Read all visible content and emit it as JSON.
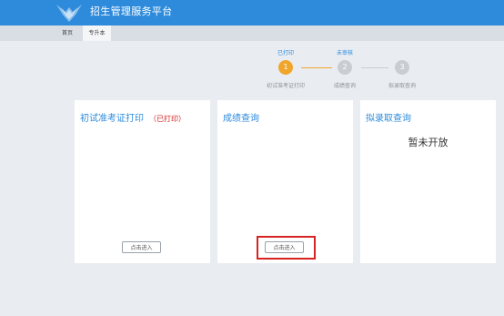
{
  "header": {
    "app_title": "招生管理服务平台"
  },
  "nav": {
    "items": [
      {
        "label": "首页"
      },
      {
        "label": "专升本"
      }
    ]
  },
  "steps": [
    {
      "status": "已打印",
      "number": "1",
      "label": "初试准考证打印"
    },
    {
      "status": "未审核",
      "number": "2",
      "label": "成绩查询"
    },
    {
      "status": "",
      "number": "3",
      "label": "拟录取查询"
    }
  ],
  "cards": [
    {
      "title": "初试准考证打印",
      "status": "（已打印）",
      "button": "点击进入"
    },
    {
      "title": "成绩查询",
      "button": "点击进入"
    },
    {
      "title": "拟录取查询",
      "message": "暂未开放"
    }
  ],
  "colors": {
    "header_bg": "#2e8bdc",
    "accent": "#2e8bdc",
    "step_done": "#f0a52b",
    "step_pending": "#c8cdd2",
    "status_red": "#d42424",
    "highlight": "#d82323"
  },
  "icons": {
    "logo": "eagle-logo-icon"
  }
}
